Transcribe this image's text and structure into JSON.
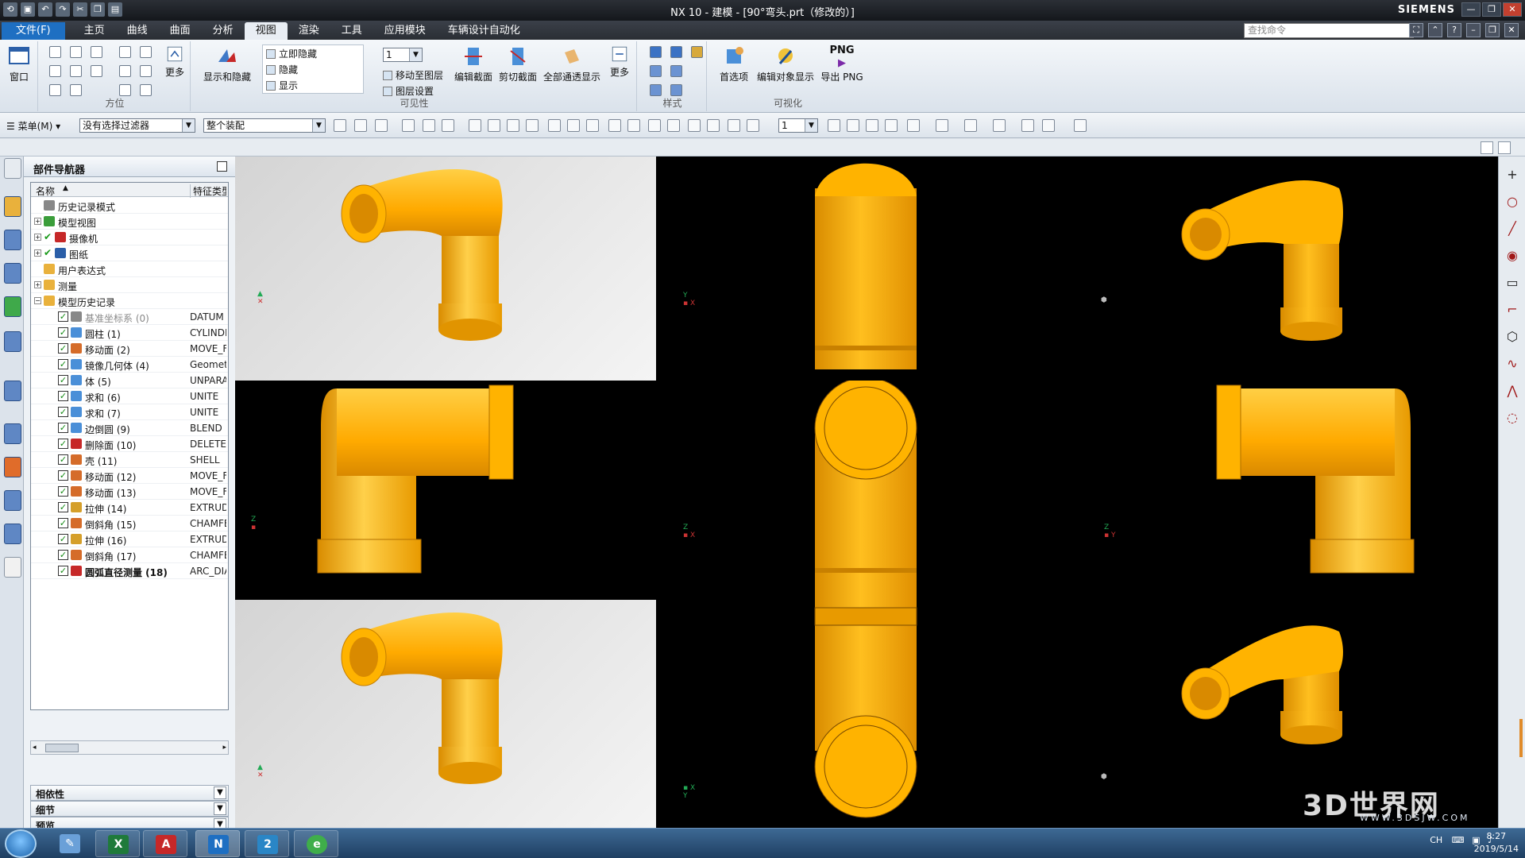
{
  "window": {
    "title": "NX 10 - 建模 - [90°弯头.prt（修改的）]",
    "brand": "SIEMENS"
  },
  "tabs": [
    {
      "label": "文件(F)"
    },
    {
      "label": "主页"
    },
    {
      "label": "曲线"
    },
    {
      "label": "曲面"
    },
    {
      "label": "分析"
    },
    {
      "label": "视图"
    },
    {
      "label": "渲染"
    },
    {
      "label": "工具"
    },
    {
      "label": "应用模块"
    },
    {
      "label": "车辆设计自动化"
    }
  ],
  "search": {
    "placeholder": "查找命令"
  },
  "ribbon": {
    "window_label": "窗口",
    "orient_group": "方位",
    "more_label": "更多",
    "show_hide_label": "显示和隐藏",
    "vis_immediate": "立即隐藏",
    "vis_hide": "隐藏",
    "vis_show": "显示",
    "layer_value": "1",
    "move_to_layer": "移动至图层",
    "layer_settings": "图层设置",
    "edit_section": "编辑截面",
    "clip_section": "剪切截面",
    "full_transparency": "全部通透显示",
    "more2": "更多",
    "visibility_group": "可见性",
    "style_group": "样式",
    "prefs": "首选项",
    "edit_obj_display": "编辑对象显示",
    "export_png": "导出 PNG",
    "png_badge": "PNG",
    "visualize_group": "可视化"
  },
  "toolbar2": {
    "menu": "菜单(M)",
    "filter": "没有选择过滤器",
    "assembly": "整个装配",
    "layer": "1"
  },
  "navigator": {
    "title": "部件导航器",
    "col_name": "名称",
    "col_type": "特征类型",
    "items": [
      {
        "label": "历史记录模式",
        "type": ""
      },
      {
        "label": "模型视图",
        "type": ""
      },
      {
        "label": "摄像机",
        "type": ""
      },
      {
        "label": "图纸",
        "type": ""
      },
      {
        "label": "用户表达式",
        "type": ""
      },
      {
        "label": "测量",
        "type": ""
      },
      {
        "label": "模型历史记录",
        "type": ""
      },
      {
        "label": "基准坐标系 (0)",
        "type": "DATUM"
      },
      {
        "label": "圆柱 (1)",
        "type": "CYLINDER"
      },
      {
        "label": "移动面 (2)",
        "type": "MOVE_FACE"
      },
      {
        "label": "镜像几何体 (4)",
        "type": "Geometry"
      },
      {
        "label": "体 (5)",
        "type": "UNPARAM"
      },
      {
        "label": "求和 (6)",
        "type": "UNITE"
      },
      {
        "label": "求和 (7)",
        "type": "UNITE"
      },
      {
        "label": "边倒圆 (9)",
        "type": "BLEND"
      },
      {
        "label": "删除面 (10)",
        "type": "DELETE"
      },
      {
        "label": "壳 (11)",
        "type": "SHELL"
      },
      {
        "label": "移动面 (12)",
        "type": "MOVE_FACE"
      },
      {
        "label": "移动面 (13)",
        "type": "MOVE_FACE"
      },
      {
        "label": "拉伸 (14)",
        "type": "EXTRUDE"
      },
      {
        "label": "倒斜角 (15)",
        "type": "CHAMFER"
      },
      {
        "label": "拉伸 (16)",
        "type": "EXTRUDE"
      },
      {
        "label": "倒斜角 (17)",
        "type": "CHAMFER"
      },
      {
        "label": "圆弧直径测量 (18)",
        "type": "ARC_DIAMETER"
      }
    ],
    "dependencies": "相依性",
    "details": "细节",
    "preview": "预览"
  },
  "watermark": {
    "main": "3D世界网",
    "url": "WWW.3DSJW.COM"
  },
  "taskbar": {
    "lang": "CH",
    "time": "8:27",
    "date": "2019/5/14"
  },
  "colors": {
    "pipe": "#ffb300",
    "pipe_dark": "#c88000",
    "viewport_bg": "#000000",
    "viewport_light": "#e6e6e6"
  }
}
